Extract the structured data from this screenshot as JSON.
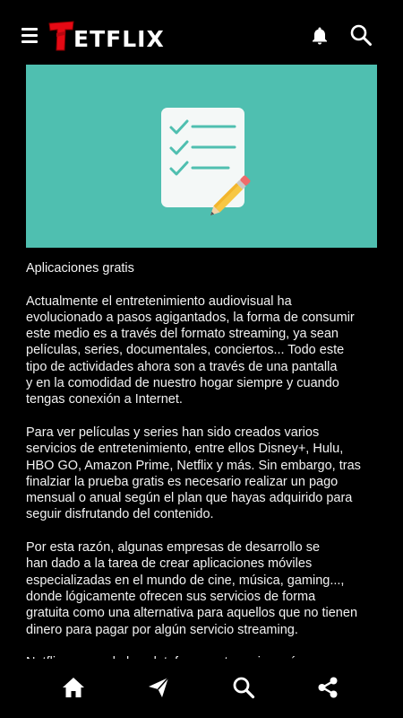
{
  "header": {
    "logo_text": "ETFLIX",
    "icons": [
      "menu-icon",
      "bell-icon",
      "search-icon"
    ]
  },
  "hero": {
    "background_color": "#4fbfb0",
    "illustration": "checklist-with-pencil"
  },
  "article": {
    "title": "Aplicaciones gratis",
    "paragraphs": [
      "Actualmente el entretenimiento audiovisual ha\nevolucionado a pasos agigantados, la forma de consumir\neste medio es a través del formato streaming, ya sean\npelículas, series, documentales, conciertos... Todo este\ntipo de actividades ahora son a través de una pantalla\ny en la comodidad de nuestro hogar siempre y cuando\ntengas conexión a Internet.",
      "Para ver películas y series han sido creados varios\nservicios de entretenimiento, entre ellos Disney+, Hulu,\nHBO GO, Amazon Prime, Netflix y más. Sin embargo, tras\nfinalziar la prueba gratis es necesario realizar un pago\nmensual o anual según el plan que hayas adquirido para\nseguir disfrutando del contenido.",
      "Por esta razón, algunas empresas de desarrollo se\nhan dado a la tarea de crear aplicaciones móviles\nespecializadas en el mundo de cine, música, gaming...,\ndonde lógicamente ofrecen sus servicios de forma\ngratuita como una alternativa para aquellos que no tienen\ndinero para pagar por algún servicio streaming.",
      "Netflix es una de las plataformas streaming más"
    ]
  },
  "bottom_nav": {
    "icons": [
      "home-icon",
      "send-icon",
      "search-icon",
      "share-icon"
    ]
  },
  "colors": {
    "background": "#000000",
    "logo_red": "#e50914",
    "text": "#f2f2f2"
  }
}
